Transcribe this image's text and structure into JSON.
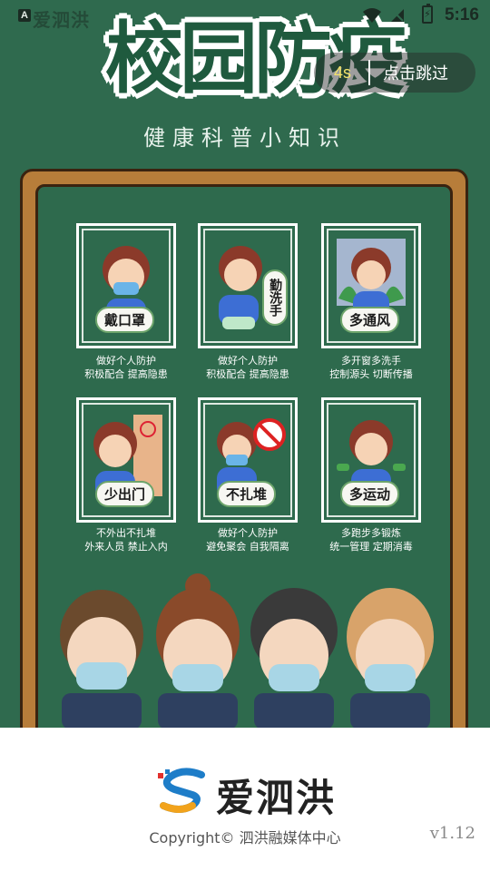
{
  "status_bar": {
    "app_mini": "爱泗洪",
    "time": "5:16"
  },
  "hero": {
    "title": "校园防疫",
    "subtitle": "健康科普小知识"
  },
  "skip": {
    "countdown": "4s",
    "label": "点击跳过"
  },
  "cards": [
    {
      "badge": "戴口罩",
      "caption": [
        "做好个人防护",
        "积极配合 提高隐患"
      ]
    },
    {
      "badge": "勤洗手",
      "caption": [
        "做好个人防护",
        "积极配合 提高隐患"
      ]
    },
    {
      "badge": "多通风",
      "caption": [
        "多开窗多洗手",
        "控制源头 切断传播"
      ]
    },
    {
      "badge": "少出门",
      "caption": [
        "不外出不扎堆",
        "外来人员 禁止入内"
      ]
    },
    {
      "badge": "不扎堆",
      "caption": [
        "做好个人防护",
        "避免聚会 自我隔离"
      ]
    },
    {
      "badge": "多运动",
      "caption": [
        "多跑步多锻炼",
        "统一管理 定期消毒"
      ]
    }
  ],
  "footer": {
    "brand": "爱泗洪",
    "copyright": "Copyright© 泗洪融媒体中心",
    "version": "v1.12"
  },
  "colors": {
    "board_green": "#2e6a4d",
    "frame_wood": "#b77d3a",
    "countdown_yellow": "#f3e36a"
  }
}
